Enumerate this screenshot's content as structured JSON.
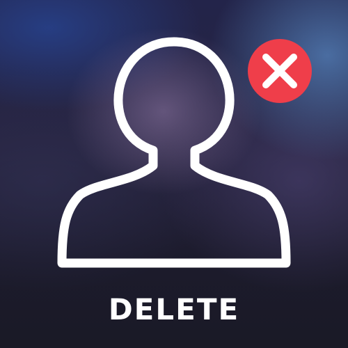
{
  "action": {
    "label": "DELETE"
  },
  "icons": {
    "avatar": "user-silhouette-icon",
    "badge": "close-x-icon"
  },
  "colors": {
    "badge_fill": "#ef3e4a",
    "badge_mark": "#ffffff",
    "outline": "#ffffff"
  }
}
